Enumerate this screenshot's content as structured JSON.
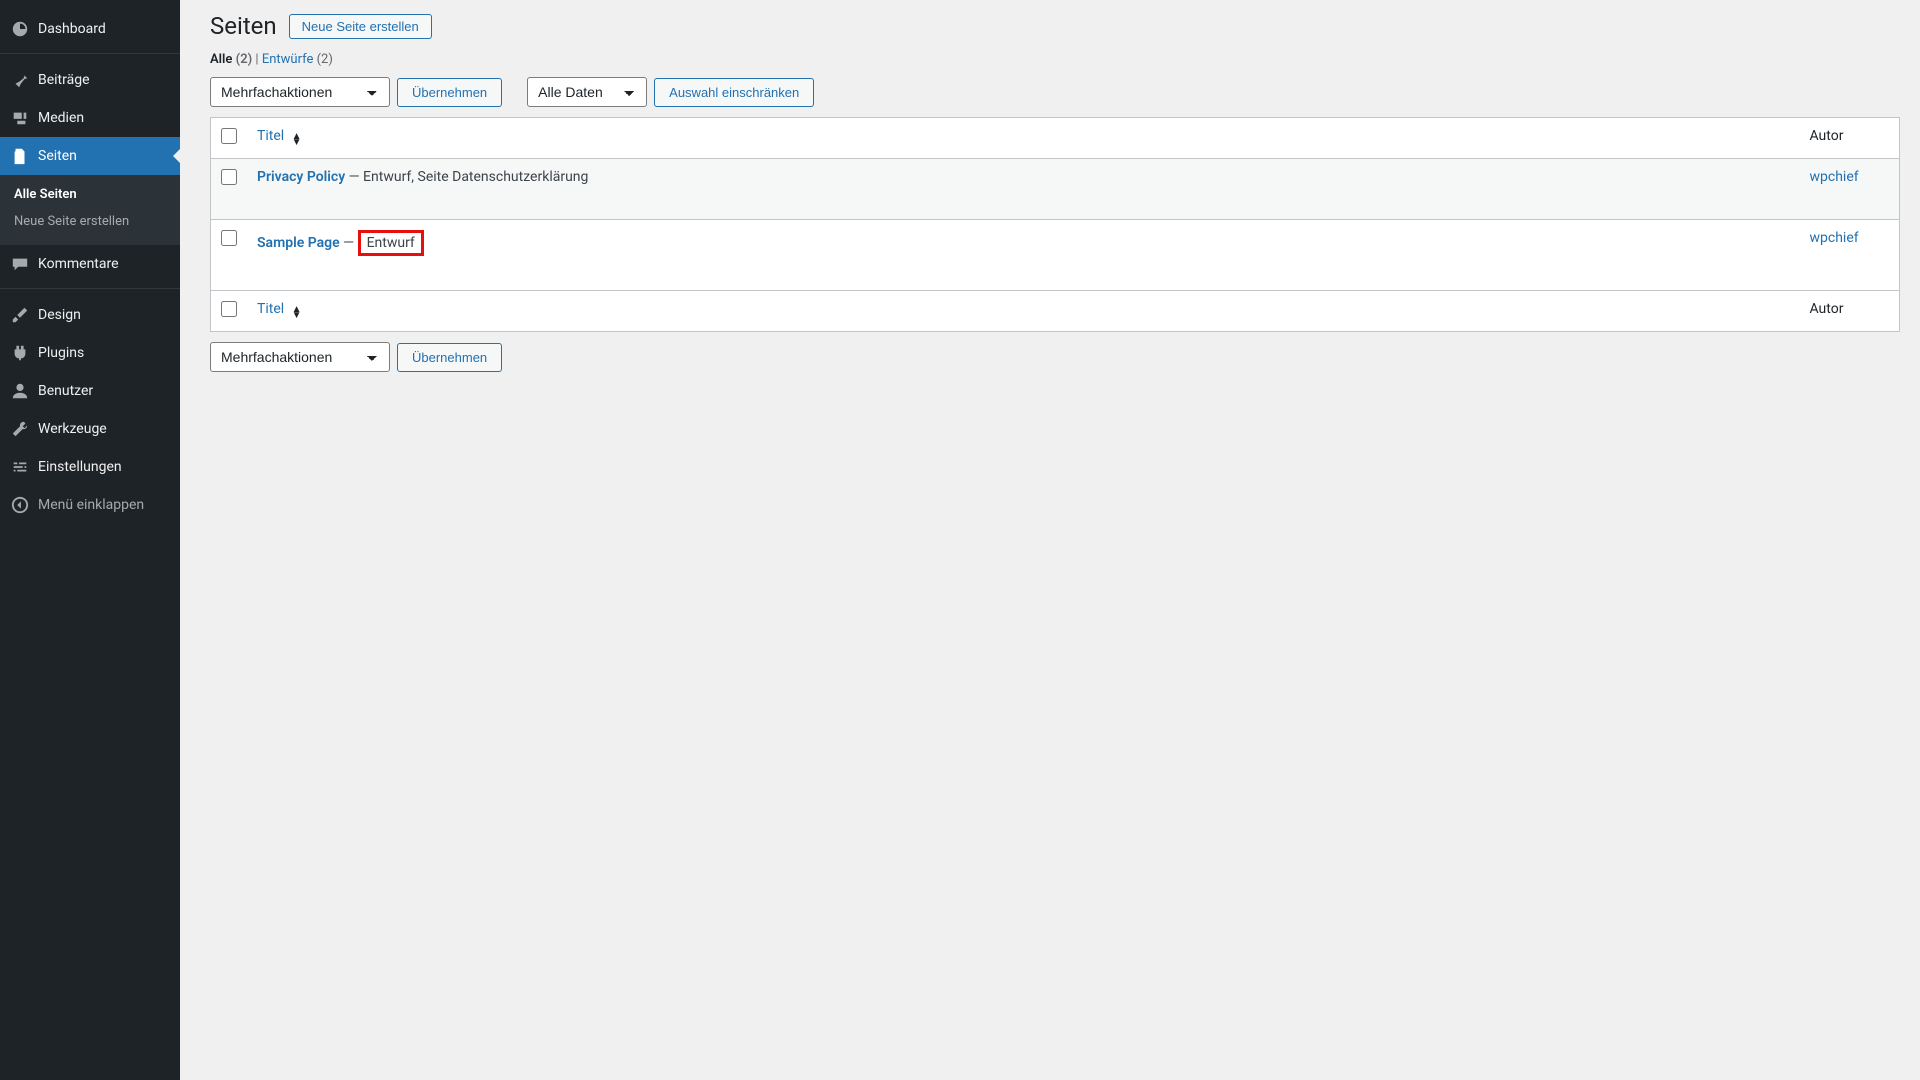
{
  "sidebar": {
    "items": [
      {
        "label": "Dashboard",
        "icon": "dashboard"
      },
      {
        "label": "Beiträge",
        "icon": "pin"
      },
      {
        "label": "Medien",
        "icon": "media"
      },
      {
        "label": "Seiten",
        "icon": "pages",
        "current": true
      },
      {
        "label": "Kommentare",
        "icon": "comment"
      },
      {
        "label": "Design",
        "icon": "brush"
      },
      {
        "label": "Plugins",
        "icon": "plugin"
      },
      {
        "label": "Benutzer",
        "icon": "user"
      },
      {
        "label": "Werkzeuge",
        "icon": "wrench"
      },
      {
        "label": "Einstellungen",
        "icon": "sliders"
      }
    ],
    "submenu": {
      "items": [
        {
          "label": "Alle Seiten",
          "current": true
        },
        {
          "label": "Neue Seite erstellen",
          "current": false
        }
      ]
    },
    "collapse_label": "Menü einklappen"
  },
  "header": {
    "title": "Seiten",
    "add_new": "Neue Seite erstellen"
  },
  "filters": {
    "all_label": "Alle",
    "all_count": "(2)",
    "sep": "  |  ",
    "drafts_label": "Entwürfe",
    "drafts_count": "(2)"
  },
  "actions": {
    "bulk_action_label": "Mehrfachaktionen",
    "apply_label": "Übernehmen",
    "date_filter_label": "Alle Daten",
    "filter_label": "Auswahl einschränken"
  },
  "columns": {
    "title": "Titel",
    "author": "Autor"
  },
  "rows": [
    {
      "title": "Privacy Policy",
      "suffix": " — Entwurf, Seite Datenschutzerklärung",
      "author": "wpchief",
      "highlight": false
    },
    {
      "title": "Sample Page",
      "suffix_prefix": " — ",
      "suffix_highlight": "Entwurf",
      "author": "wpchief",
      "highlight": true
    }
  ]
}
